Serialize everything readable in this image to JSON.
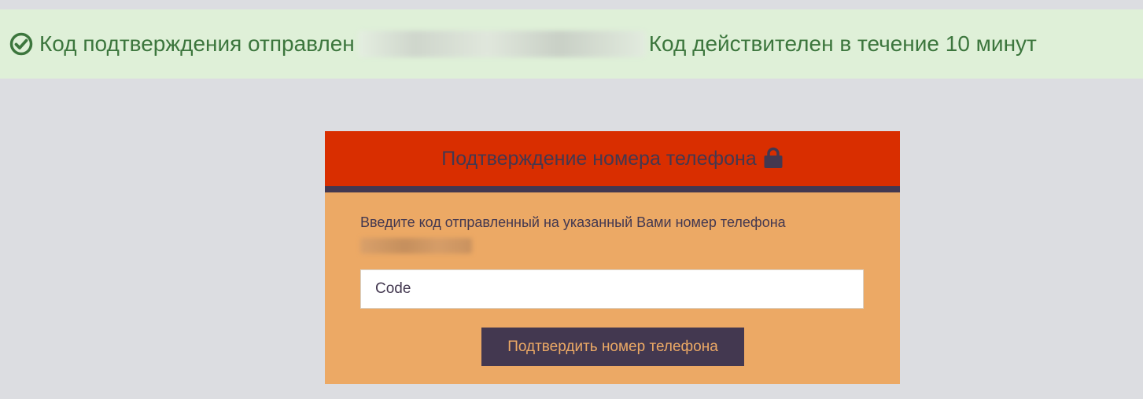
{
  "alert": {
    "icon": "check-circle-icon",
    "sent_text": "Код подтверждения отправлен",
    "validity_text": "Код действителен в течение 10 минут",
    "color": "#3c763d",
    "background": "#dff0d8"
  },
  "panel": {
    "title": "Подтверждение номера телефона",
    "title_icon": "lock-icon",
    "instruction": "Введите код отправленный на указанный Вами номер телефона",
    "code_input": {
      "placeholder": "Code",
      "value": ""
    },
    "confirm_button_label": "Подтвердить номер телефона",
    "colors": {
      "header": "#d92e00",
      "body": "#eca965",
      "accent": "#433850"
    }
  }
}
